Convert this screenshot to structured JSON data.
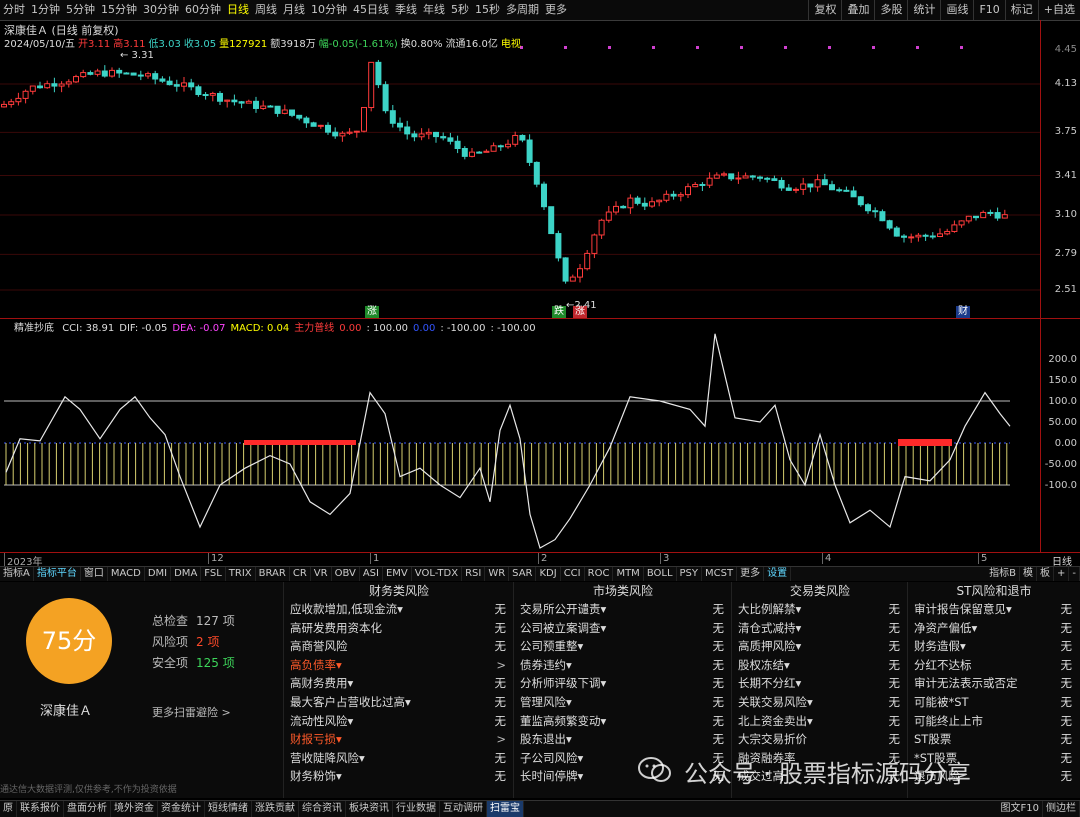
{
  "toolbar": {
    "periods": [
      "分时",
      "1分钟",
      "5分钟",
      "15分钟",
      "30分钟",
      "60分钟",
      "日线",
      "周线",
      "月线",
      "10分钟",
      "45日线",
      "季线",
      "年线",
      "5秒",
      "15秒",
      "多周期",
      "更多"
    ],
    "active_period": "日线",
    "right_items": [
      "复权",
      "叠加",
      "多股",
      "统计",
      "画线",
      "F10",
      "标记",
      "+自选"
    ]
  },
  "stock": {
    "title_line": "深康佳Ａ (日线 前复权)",
    "info": [
      {
        "text": "2024/05/10/五",
        "color": "#dddddd"
      },
      {
        "text": "开3.11",
        "color": "#ff3b3b"
      },
      {
        "text": "高3.11",
        "color": "#ff3b3b"
      },
      {
        "text": "低3.03",
        "color": "#3dd4c7"
      },
      {
        "text": "收3.05",
        "color": "#3dd4c7"
      },
      {
        "text": "量127921",
        "color": "#ffff00"
      },
      {
        "text": "额3918万",
        "color": "#dddddd"
      },
      {
        "text": "幅-0.05(-1.61%)",
        "color": "#3dd45a"
      },
      {
        "text": "换0.80%",
        "color": "#dddddd"
      },
      {
        "text": "流通16.0亿",
        "color": "#dddddd"
      },
      {
        "text": "电视",
        "color": "#ffff00"
      }
    ],
    "high_label": "3.31",
    "low_label": "2.41"
  },
  "main_axis": {
    "ticks": [
      "4.13",
      "3.75",
      "3.41",
      "3.10",
      "2.79",
      "2.51"
    ],
    "top_tick": "4.45"
  },
  "markers": [
    {
      "text": "涨",
      "bg": "#1f8a2a",
      "color": "#ffffff"
    },
    {
      "text": "跌",
      "bg": "#1f8a2a",
      "color": "#ffffff"
    },
    {
      "text": "涨",
      "bg": "#c0272d",
      "color": "#ffffff"
    },
    {
      "text": "财",
      "bg": "#1a3a8a",
      "color": "#ffffff"
    }
  ],
  "indicator": {
    "name": "精准抄底",
    "items": [
      {
        "text": "CCI: 38.91",
        "color": "#dddddd"
      },
      {
        "text": "DIF: -0.05",
        "color": "#dddddd"
      },
      {
        "text": "DEA: -0.07",
        "color": "#ff44ff"
      },
      {
        "text": "MACD: 0.04",
        "color": "#ffff00"
      },
      {
        "text": "主力普线",
        "color": "#ff3b3b"
      },
      {
        "text": "0.00",
        "color": "#ff3b3b"
      },
      {
        "text": ": 100.00",
        "color": "#dddddd"
      },
      {
        "text": "0.00",
        "color": "#3355ff"
      },
      {
        "text": ": -100.00",
        "color": "#dddddd"
      },
      {
        "text": ": -100.00",
        "color": "#dddddd"
      }
    ],
    "ticks": [
      "200.0",
      "150.0",
      "100.0",
      "50.00",
      "0.00",
      "-50.00",
      "-100.0"
    ]
  },
  "dates": [
    {
      "label": "2023年"
    },
    {
      "label": "12"
    },
    {
      "label": "1"
    },
    {
      "label": "2"
    },
    {
      "label": "3"
    },
    {
      "label": "4"
    },
    {
      "label": "5"
    }
  ],
  "date_unit": "日线",
  "tabs": [
    "指标A",
    "指标平台",
    "窗口",
    "MACD",
    "DMI",
    "DMA",
    "FSL",
    "TRIX",
    "BRAR",
    "CR",
    "VR",
    "OBV",
    "ASI",
    "EMV",
    "VOL-TDX",
    "RSI",
    "WR",
    "SAR",
    "KDJ",
    "CCI",
    "ROC",
    "MTM",
    "BOLL",
    "PSY",
    "MCST",
    "更多",
    "设置"
  ],
  "tabs_right": [
    "指标B",
    "模",
    "板",
    "+",
    "-"
  ],
  "score": {
    "value": "75分",
    "stock": "深康佳Ａ",
    "total_label": "总检查",
    "total": "127 项",
    "risk_label": "风险项",
    "risk": "2 项",
    "safe_label": "安全项",
    "safe": "125 项",
    "more": "更多扫雷避险 >",
    "disclaimer": "通达信大数据评测,仅供参考,不作为投资依据"
  },
  "columns": [
    {
      "title": "财务类风险",
      "items": [
        {
          "label": "应收款增加,低现金流▾",
          "status": "无",
          "risk": false
        },
        {
          "label": "高研发费用资本化",
          "status": "无",
          "risk": false
        },
        {
          "label": "高商誉风险",
          "status": "无",
          "risk": false
        },
        {
          "label": "高负债率▾",
          "status": ">",
          "risk": true
        },
        {
          "label": "高财务费用▾",
          "status": "无",
          "risk": false
        },
        {
          "label": "最大客户占营收比过高▾",
          "status": "无",
          "risk": false
        },
        {
          "label": "流动性风险▾",
          "status": "无",
          "risk": false
        },
        {
          "label": "财报亏损▾",
          "status": ">",
          "risk": true
        },
        {
          "label": "营收陡降风险▾",
          "status": "无",
          "risk": false
        },
        {
          "label": "财务粉饰▾",
          "status": "无",
          "risk": false
        }
      ]
    },
    {
      "title": "市场类风险",
      "items": [
        {
          "label": "交易所公开谴责▾",
          "status": "无",
          "risk": false
        },
        {
          "label": "公司被立案调查▾",
          "status": "无",
          "risk": false
        },
        {
          "label": "公司预重整▾",
          "status": "无",
          "risk": false
        },
        {
          "label": "债券违约▾",
          "status": "无",
          "risk": false
        },
        {
          "label": "分析师评级下调▾",
          "status": "无",
          "risk": false
        },
        {
          "label": "管理风险▾",
          "status": "无",
          "risk": false
        },
        {
          "label": "董监高频繁变动▾",
          "status": "无",
          "risk": false
        },
        {
          "label": "股东退出▾",
          "status": "无",
          "risk": false
        },
        {
          "label": "子公司风险▾",
          "status": "无",
          "risk": false
        },
        {
          "label": "长时间停牌▾",
          "status": "无",
          "risk": false
        }
      ]
    },
    {
      "title": "交易类风险",
      "items": [
        {
          "label": "大比例解禁▾",
          "status": "无",
          "risk": false
        },
        {
          "label": "清仓式减持▾",
          "status": "无",
          "risk": false
        },
        {
          "label": "高质押风险▾",
          "status": "无",
          "risk": false
        },
        {
          "label": "股权冻结▾",
          "status": "无",
          "risk": false
        },
        {
          "label": "长期不分红▾",
          "status": "无",
          "risk": false
        },
        {
          "label": "关联交易风险▾",
          "status": "无",
          "risk": false
        },
        {
          "label": "北上资金卖出▾",
          "status": "无",
          "risk": false
        },
        {
          "label": "大宗交易折价",
          "status": "无",
          "risk": false
        },
        {
          "label": "融资融券率",
          "status": "无",
          "risk": false
        },
        {
          "label": "成交过高",
          "status": "无",
          "risk": false
        }
      ]
    },
    {
      "title": "ST风险和退市",
      "items": [
        {
          "label": "审计报告保留意见▾",
          "status": "无",
          "risk": false
        },
        {
          "label": "净资产偏低▾",
          "status": "无",
          "risk": false
        },
        {
          "label": "财务造假▾",
          "status": "无",
          "risk": false
        },
        {
          "label": "分红不达标",
          "status": "无",
          "risk": false
        },
        {
          "label": "审计无法表示或否定",
          "status": "无",
          "risk": false
        },
        {
          "label": "可能被*ST",
          "status": "无",
          "risk": false
        },
        {
          "label": "可能终止上市",
          "status": "无",
          "risk": false
        },
        {
          "label": "ST股票",
          "status": "无",
          "risk": false
        },
        {
          "label": "*ST股票",
          "status": "无",
          "risk": false
        },
        {
          "label": "退市风险",
          "status": "无",
          "risk": false
        }
      ]
    }
  ],
  "bottom": [
    "联系报价",
    "盘面分析",
    "境外资金",
    "资金统计",
    "短线情绪",
    "涨跌贡献",
    "综合资讯",
    "板块资讯",
    "行业数据",
    "互动调研",
    "扫雷宝"
  ],
  "bottom_active": "扫雷宝",
  "bottom_right": [
    "图文F10",
    "侧边栏"
  ],
  "watermark": "公众号 · 股票指标源码分享",
  "colors": {
    "up": "#ff3b3b",
    "down": "#3dd4c7",
    "accent": "#f4a223",
    "frame": "#a01010"
  }
}
